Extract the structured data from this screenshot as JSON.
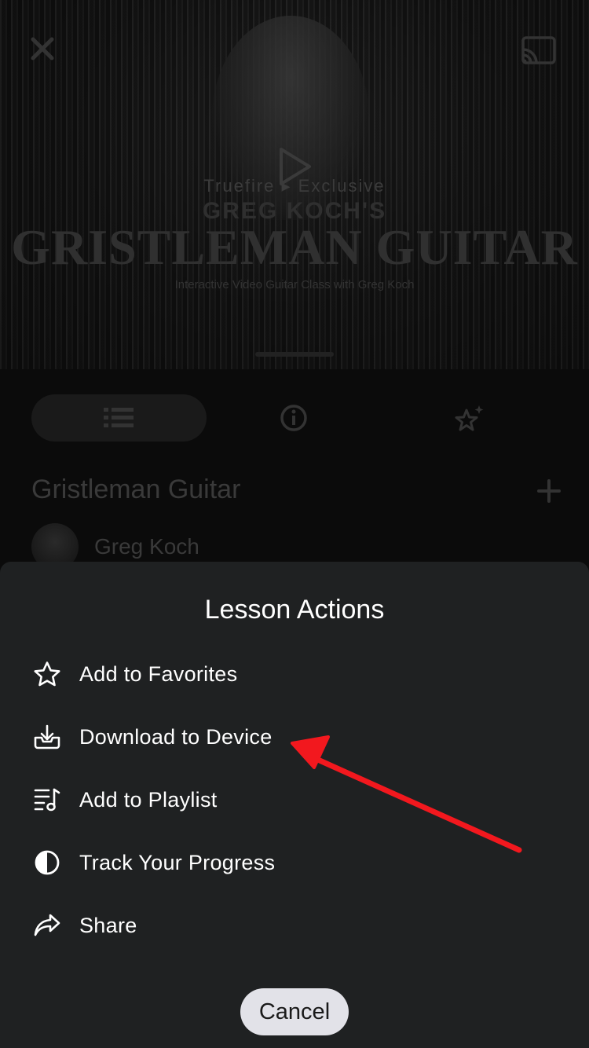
{
  "background": {
    "hero": {
      "eyebrow": "Truefire ▸ Exclusive",
      "presenter": "GREG KOCH'S",
      "title": "GRISTLEMAN GUITAR",
      "tagline": "Interactive Video Guitar Class with Greg Koch"
    },
    "course_title": "Gristleman Guitar",
    "author_name": "Greg Koch",
    "icons": {
      "close": "close-icon",
      "cast": "cast-icon",
      "play": "play-icon",
      "list": "list-icon",
      "info": "info-icon",
      "sparkle": "sparkle-star-icon",
      "add": "plus-icon"
    }
  },
  "sheet": {
    "title": "Lesson Actions",
    "actions": [
      {
        "label": "Add to Favorites",
        "icon": "star-icon"
      },
      {
        "label": "Download to Device",
        "icon": "download-tray-icon"
      },
      {
        "label": "Add to Playlist",
        "icon": "playlist-icon"
      },
      {
        "label": "Track Your Progress",
        "icon": "half-circle-icon"
      },
      {
        "label": "Share",
        "icon": "share-arrow-icon"
      }
    ],
    "cancel_label": "Cancel"
  },
  "colors": {
    "sheet_bg": "#1f2122",
    "cancel_bg": "#e2e2e8",
    "annotation_arrow": "#f2181e"
  }
}
